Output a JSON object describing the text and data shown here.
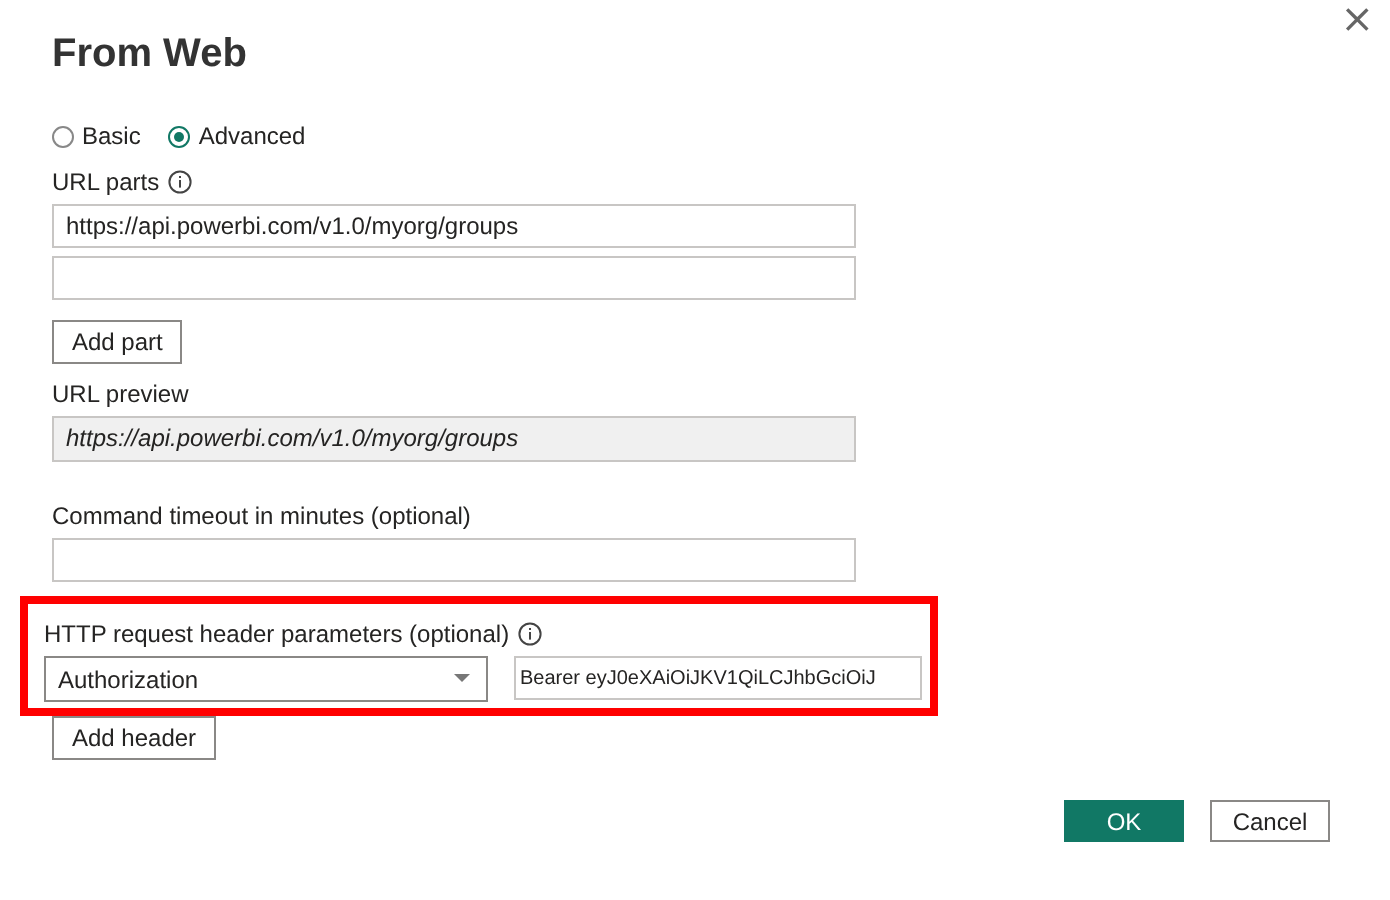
{
  "dialog": {
    "title": "From Web",
    "close": "×"
  },
  "modes": [
    {
      "label": "Basic",
      "selected": false
    },
    {
      "label": "Advanced",
      "selected": true
    }
  ],
  "url_parts": {
    "label": "URL parts",
    "fields": [
      {
        "kind": "text",
        "value": "https://api.powerbi.com/v1.0/myorg/groups"
      },
      {
        "kind": "text"
      }
    ],
    "add_button": "Add part"
  },
  "url_preview": {
    "label": "URL preview",
    "value": "https://api.powerbi.com/v1.0/myorg/groups"
  },
  "command_timeout": {
    "label": "Command timeout in minutes (optional)"
  },
  "headers": {
    "label": "HTTP request header parameters (optional)",
    "name": "Authorization",
    "value": "Bearer eyJ0eXAiOiJKV1QiLCJhbGciOiJ",
    "add_button": "Add header"
  },
  "buttons": [
    {
      "label": "OK",
      "kind": "primary"
    },
    {
      "label": "Cancel",
      "kind": "secondary"
    }
  ]
}
